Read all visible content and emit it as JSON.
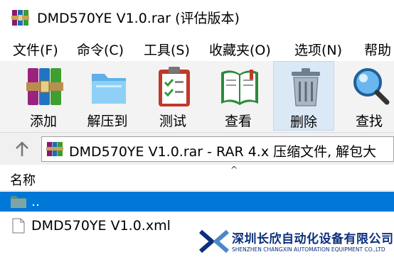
{
  "window": {
    "title": "DMD570YE V1.0.rar (评估版本)"
  },
  "menu": [
    {
      "label": "文件(F)"
    },
    {
      "label": "命令(C)"
    },
    {
      "label": "工具(S)"
    },
    {
      "label": "收藏夹(O)"
    },
    {
      "label": "选项(N)"
    },
    {
      "label": "帮助"
    }
  ],
  "toolbar": [
    {
      "label": "添加",
      "icon": "books-icon"
    },
    {
      "label": "解压到",
      "icon": "folder-icon"
    },
    {
      "label": "测试",
      "icon": "clipboard-check-icon"
    },
    {
      "label": "查看",
      "icon": "open-book-icon"
    },
    {
      "label": "删除",
      "icon": "trash-icon"
    },
    {
      "label": "查找",
      "icon": "magnifier-icon"
    }
  ],
  "address": {
    "text": "DMD570YE V1.0.rar - RAR 4.x 压缩文件, 解包大"
  },
  "filelist": {
    "column_name": "名称",
    "rows": [
      {
        "name": "..",
        "type": "parent-folder",
        "selected": true
      },
      {
        "name": "DMD570YE V1.0.xml",
        "type": "file",
        "selected": false
      }
    ]
  },
  "watermark": {
    "company_cn": "深圳长欣自动化设备有限公司",
    "company_en": "SHENZHEN CHANGXIN AUTOMATION EQUIPMENT CO.,LTD"
  },
  "colors": {
    "selection": "#0078d7",
    "toolbar_active": "#dbe8f6",
    "brand": "#0c2f7c"
  }
}
